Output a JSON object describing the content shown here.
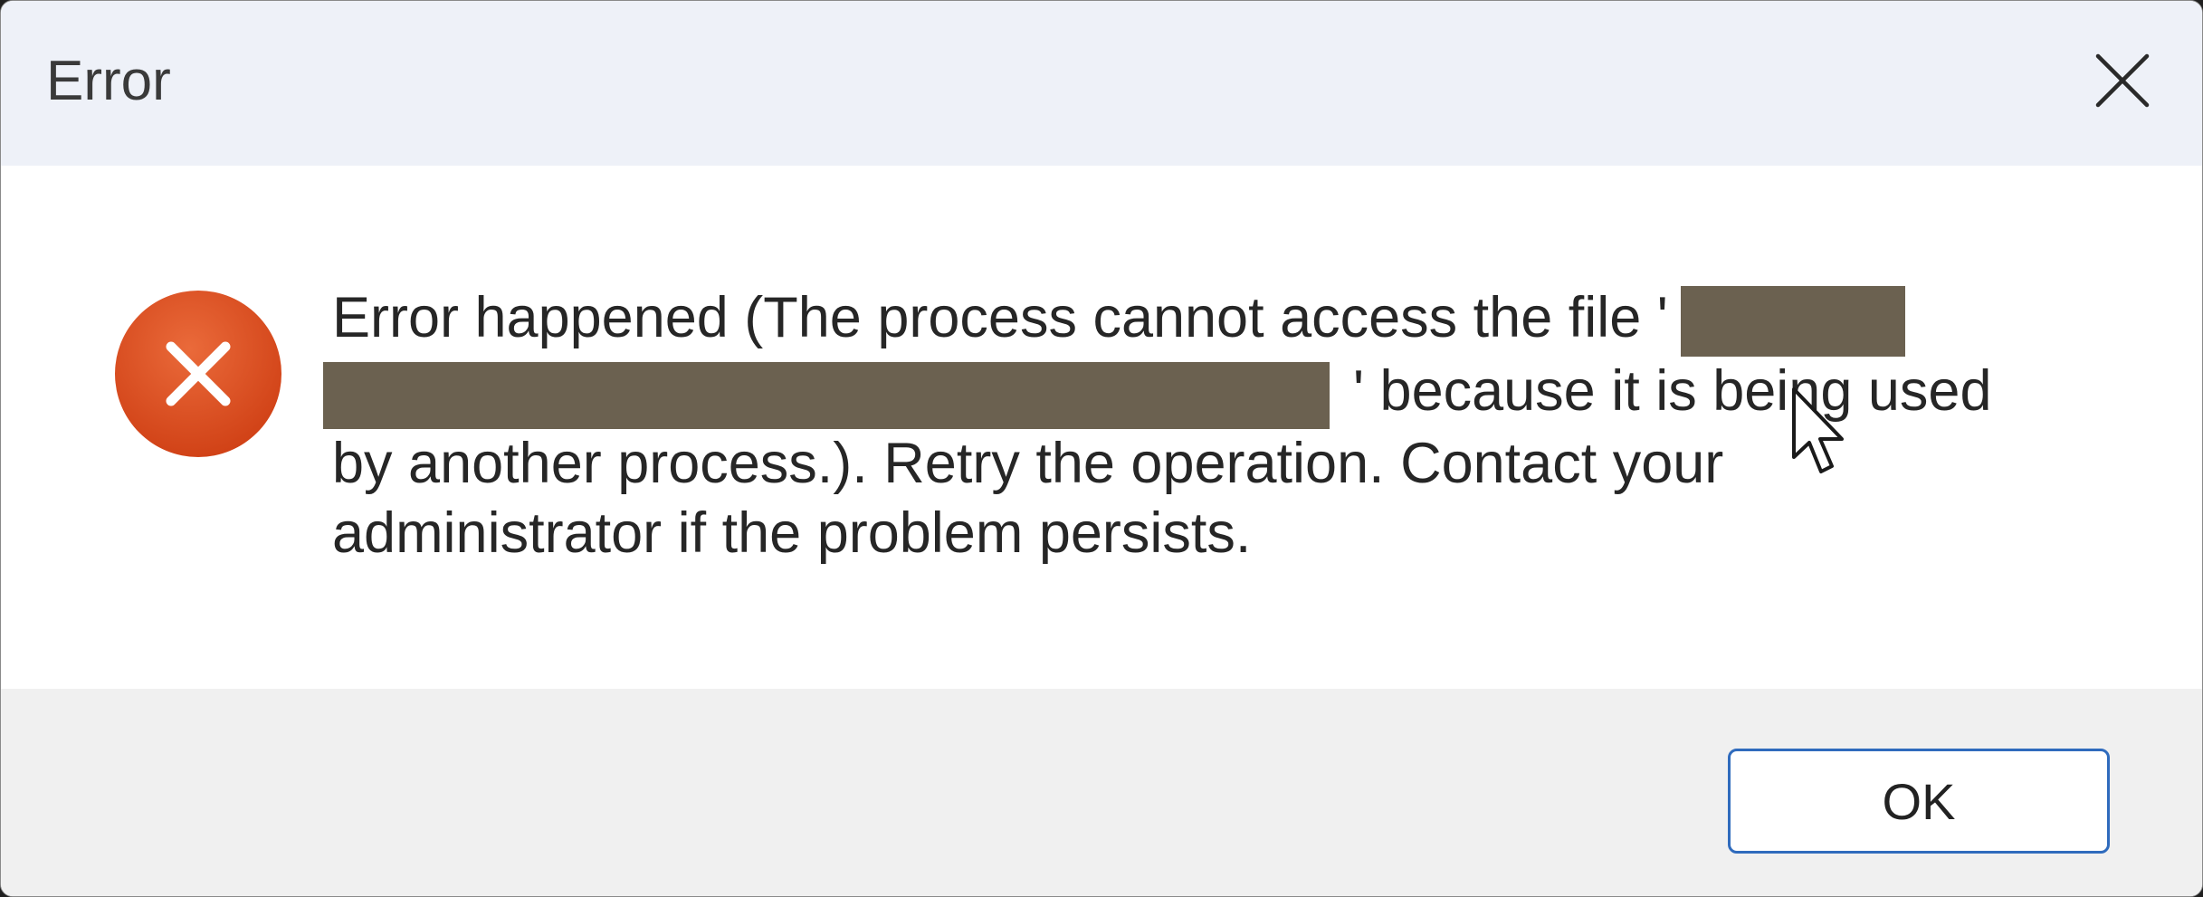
{
  "window": {
    "title": "Error",
    "close_icon": "close-icon"
  },
  "message": {
    "icon": "error-icon",
    "part1": "Error happened (The process cannot access the file '",
    "part2": "' because it is being used by another process.). Retry the operation. Contact your administrator if the problem persists."
  },
  "buttons": {
    "ok_label": "OK"
  },
  "colors": {
    "accent": "#2f6bbd",
    "error_icon": "#d84a1f",
    "redaction": "#6b6150"
  }
}
